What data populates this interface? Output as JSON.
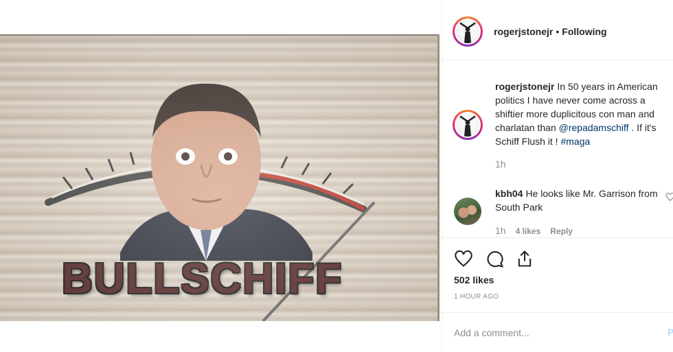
{
  "media": {
    "headline": "BULLSCHIFF"
  },
  "header": {
    "username": "rogerjstonejr",
    "separator": "•",
    "follow_status": "Following",
    "avatar_icon": "profile-photo-icon"
  },
  "caption": {
    "username": "rogerjstonejr",
    "text_before": "In 50 years in American politics I have never come across a shiftier more duplicitous con man and charlatan than ",
    "mention": "@repadamschiff",
    "text_middle": " . If it's Schiff Flush it ! ",
    "hashtag": "#maga",
    "time": "1h"
  },
  "comment": {
    "username": "kbh04",
    "text": "He looks like Mr. Garrison from South Park",
    "time": "1h",
    "likes": "4 likes",
    "reply": "Reply"
  },
  "actions": {
    "like_icon": "heart-icon",
    "comment_icon": "comment-icon",
    "share_icon": "share-icon",
    "likes_count": "502 likes",
    "posted_ago": "1 HOUR AGO"
  },
  "add_comment": {
    "placeholder": "Add a comment...",
    "post_label": "Post"
  },
  "colors": {
    "link": "#003569",
    "secondary_text": "#8e8e8e",
    "border": "#efefef",
    "story_ring_start": "#f58529",
    "story_ring_end": "#8134af"
  }
}
